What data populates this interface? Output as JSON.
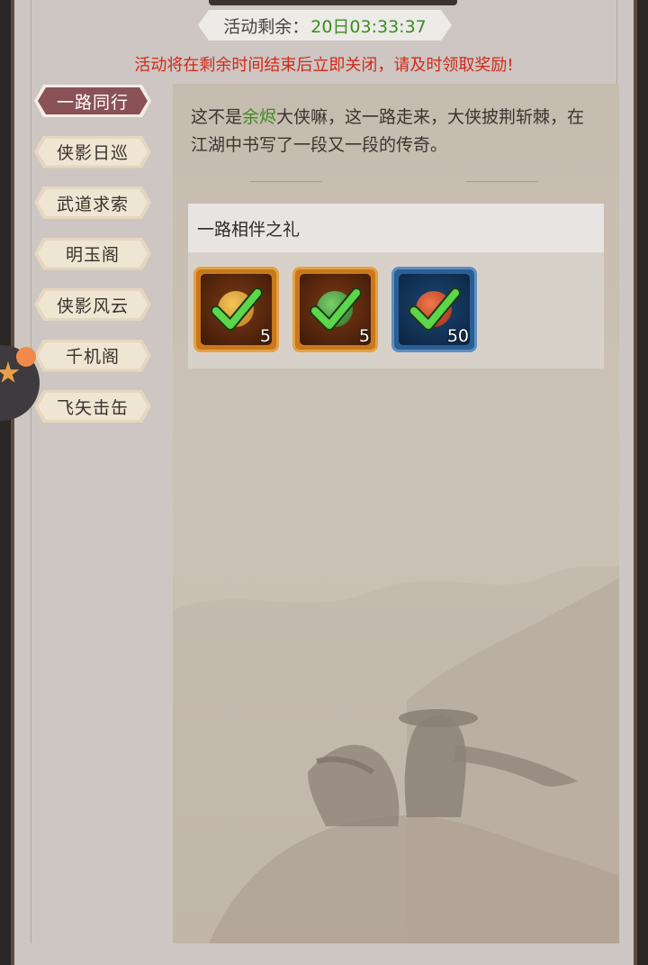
{
  "timer": {
    "label": "活动剩余：",
    "value": "20日03:33:37"
  },
  "notice": "活动将在剩余时间结束后立即关闭，请及时领取奖励!",
  "tabs": [
    {
      "label": "一路同行",
      "active": true
    },
    {
      "label": "侠影日巡",
      "active": false
    },
    {
      "label": "武道求索",
      "active": false
    },
    {
      "label": "明玉阁",
      "active": false
    },
    {
      "label": "侠影风云",
      "active": false
    },
    {
      "label": "千机阁",
      "active": false
    },
    {
      "label": "飞矢击缶",
      "active": false
    }
  ],
  "description": {
    "part1": "这不是",
    "name": "余烬",
    "part2": "大侠嘛，这一路走来，大侠披荆斩棘，在江湖中书写了一段又一段的传奇。"
  },
  "gift": {
    "title": "一路相伴之礼",
    "items": [
      {
        "icon": "gold-coin-icon",
        "quantity": "5",
        "frame": "orange",
        "claimed": true
      },
      {
        "icon": "jade-book-icon",
        "quantity": "5",
        "frame": "orange",
        "claimed": true
      },
      {
        "icon": "red-orb-icon",
        "quantity": "50",
        "frame": "blue",
        "claimed": true
      }
    ]
  },
  "colors": {
    "accent_green": "#3c8c1e",
    "notice_red": "#d12a1a",
    "active_tab": "#8a5257"
  }
}
